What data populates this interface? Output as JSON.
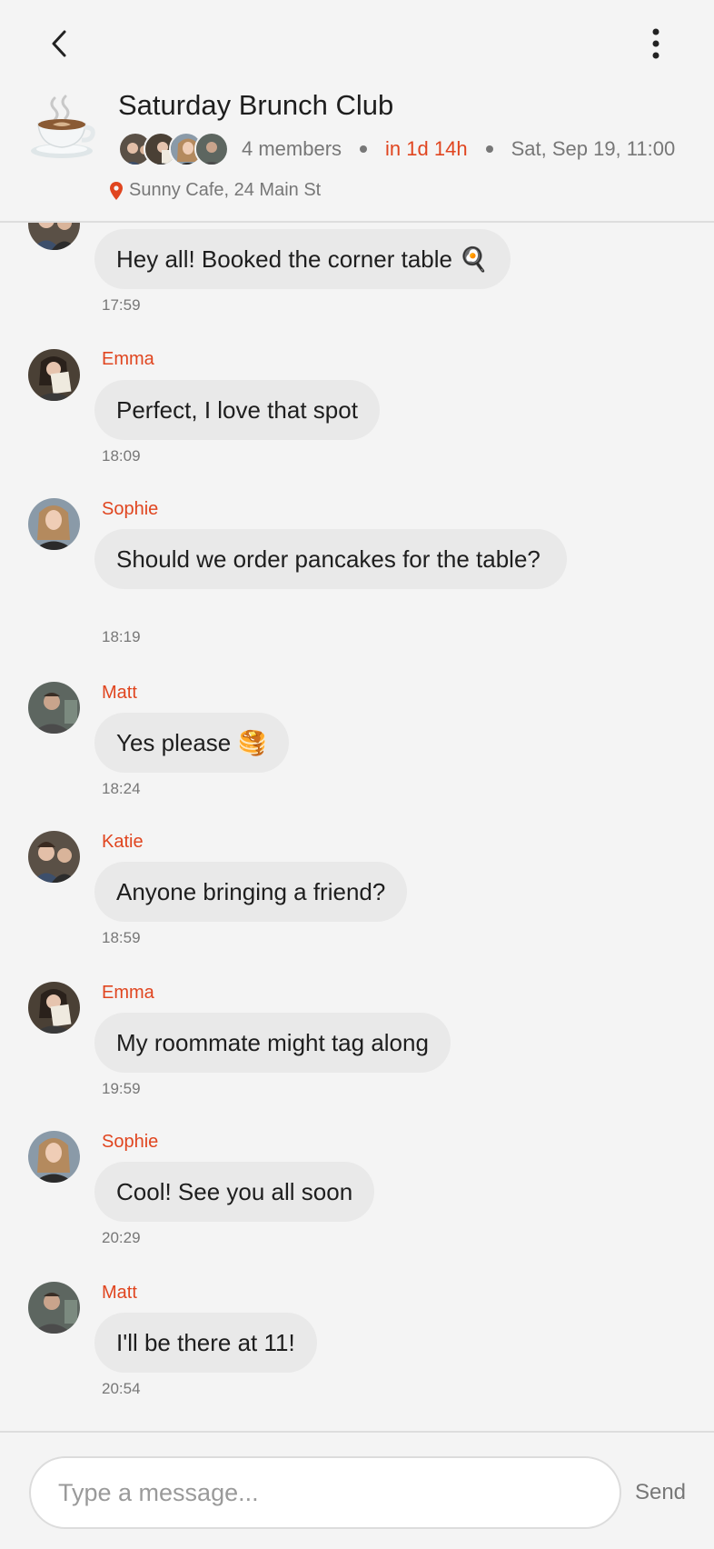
{
  "header": {
    "back_icon": "chevron-left-icon",
    "more_icon": "more-vertical-icon",
    "group_icon": "coffee-cup-icon",
    "title": "Saturday Brunch Club",
    "members": "4 members",
    "countdown": "in 1d 14h",
    "datetime": "Sat, Sep 19, 11:00",
    "location": "Sunny Cafe, 24 Main St",
    "location_icon": "map-pin-icon"
  },
  "messages": [
    {
      "sender": "",
      "text": "Hey all! Booked the corner table 🍳",
      "time": "17:59"
    },
    {
      "sender": "Emma",
      "text": "Perfect, I love that spot",
      "time": "18:09"
    },
    {
      "sender": "Sophie",
      "text": "Should we order pancakes for the table?",
      "time": "18:19"
    },
    {
      "sender": "Matt",
      "text": "Yes please 🥞",
      "time": "18:24"
    },
    {
      "sender": "Katie",
      "text": "Anyone bringing a friend?",
      "time": "18:59"
    },
    {
      "sender": "Emma",
      "text": "My roommate might tag along",
      "time": "19:59"
    },
    {
      "sender": "Sophie",
      "text": "Cool! See you all soon",
      "time": "20:29"
    },
    {
      "sender": "Matt",
      "text": "I'll be there at 11!",
      "time": "20:54"
    }
  ],
  "composer": {
    "placeholder": "Type a message...",
    "send_label": "Send"
  },
  "colors": {
    "accent": "#e0451f",
    "bubble": "#e9e9e9",
    "background": "#f4f4f4"
  }
}
